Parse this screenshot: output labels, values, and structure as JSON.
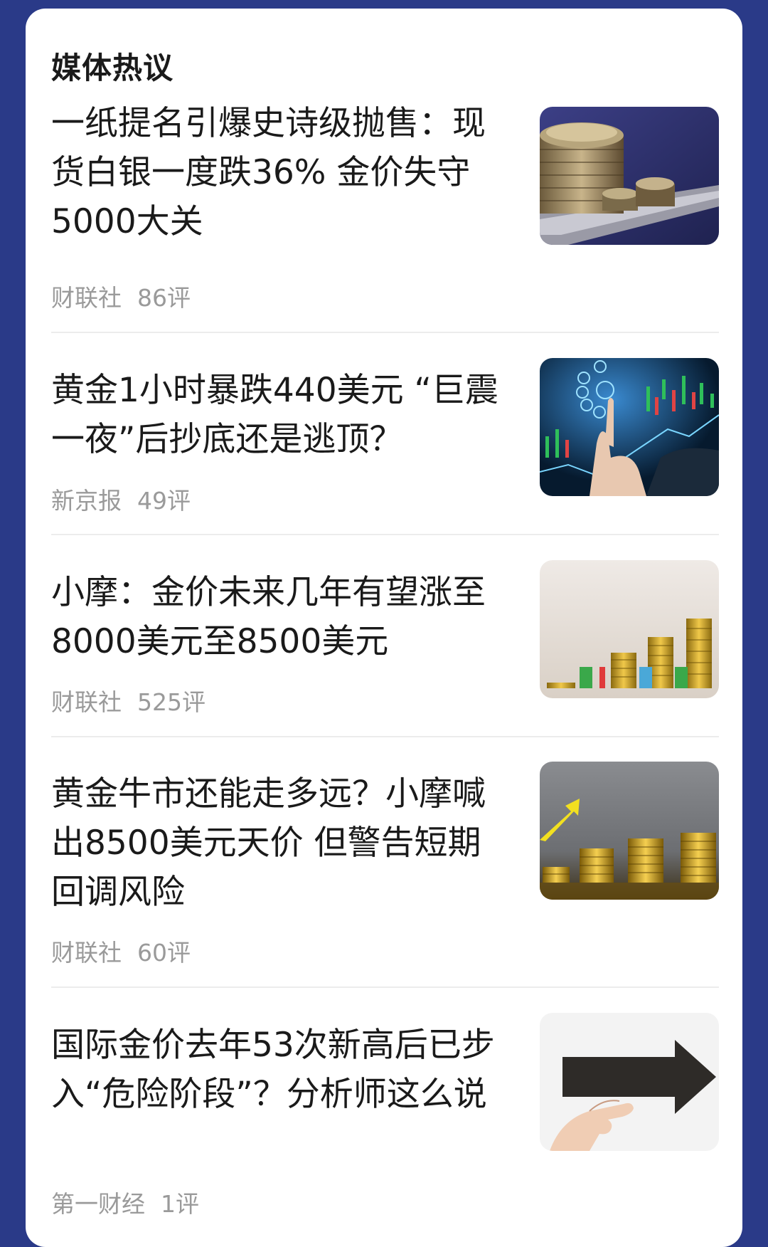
{
  "section": {
    "title": "媒体热议"
  },
  "articles": [
    {
      "title": "一纸提名引爆史诗级抛售：现货白银一度跌36% 金价失守5000大关",
      "source": "财联社",
      "comments": "86评",
      "thumbnail_icon": "coins-on-laptop-image"
    },
    {
      "title": "黄金1小时暴跌440美元 “巨震一夜”后抄底还是逃顶？",
      "source": "新京报",
      "comments": "49评",
      "thumbnail_icon": "finance-chart-hand-image"
    },
    {
      "title": "小摩：金价未来几年有望涨至8000美元至8500美元",
      "source": "财联社",
      "comments": "525评",
      "thumbnail_icon": "rise-coin-stacks-image"
    },
    {
      "title": "黄金牛市还能走多远？小摩喊出8500美元天价 但警告短期回调风险",
      "source": "财联社",
      "comments": "60评",
      "thumbnail_icon": "gold-coin-stacks-arrow-image"
    },
    {
      "title": "国际金价去年53次新高后已步入“危险阶段”？分析师这么说",
      "source": "第一财经",
      "comments": "1评",
      "thumbnail_icon": "hand-holding-arrow-image"
    }
  ]
}
